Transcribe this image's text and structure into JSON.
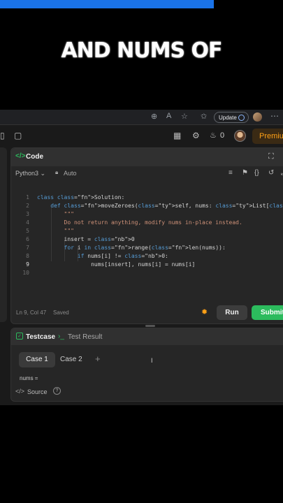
{
  "caption": "AND NUMS OF",
  "browser": {
    "update_label": "Update"
  },
  "app": {
    "streak": "0",
    "premium_label": "Premium"
  },
  "code_panel": {
    "title": "Code",
    "language": "Python3",
    "auto_label": "Auto",
    "status": "Ln 9, Col 47",
    "saved": "Saved",
    "run_label": "Run",
    "submit_label": "Submit",
    "lines": [
      "class Solution:",
      "    def moveZeroes(self, nums: List[int]) -> None:",
      "        \"\"\"",
      "        Do not return anything, modify nums in-place instead.",
      "        \"\"\"",
      "        insert = 0",
      "        for i in range(len(nums)):",
      "            if nums[i] != 0:",
      "                nums[insert], nums[i] = nums[i]",
      ""
    ]
  },
  "testcase_panel": {
    "tab_testcase": "Testcase",
    "tab_result": "Test Result",
    "case1": "Case 1",
    "case2": "Case 2",
    "param_label": "nums =",
    "source_label": "Source"
  },
  "colors": {
    "accent_green": "#2cbb5d",
    "premium_orange": "#ffa116",
    "progress_blue": "#1a73e8"
  }
}
